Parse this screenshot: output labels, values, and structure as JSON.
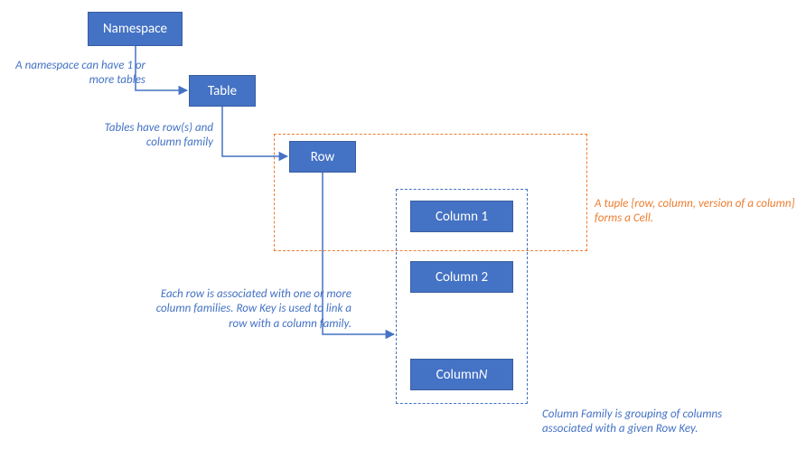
{
  "boxes": {
    "namespace": "Namespace",
    "table": "Table",
    "row": "Row",
    "column1": "Column 1",
    "column2": "Column 2",
    "columnN_prefix": "Column ",
    "columnN_ital": "N"
  },
  "annotations": {
    "namespace_note": "A namespace can have 1 or more tables",
    "table_note": "Tables have row(s) and column family",
    "row_note": "Each row is associated with one or more column families. Row Key is used to link a row with a column family.",
    "cell_note": "A tuple {row, column, version of a column} forms a Cell.",
    "cf_note": "Column Family is grouping of columns associated with a given Row Key."
  },
  "colors": {
    "box_fill": "#4472C4",
    "annot_color": "#4472C4",
    "cell_border": "#ED7D31",
    "cf_border": "#4472C4"
  }
}
